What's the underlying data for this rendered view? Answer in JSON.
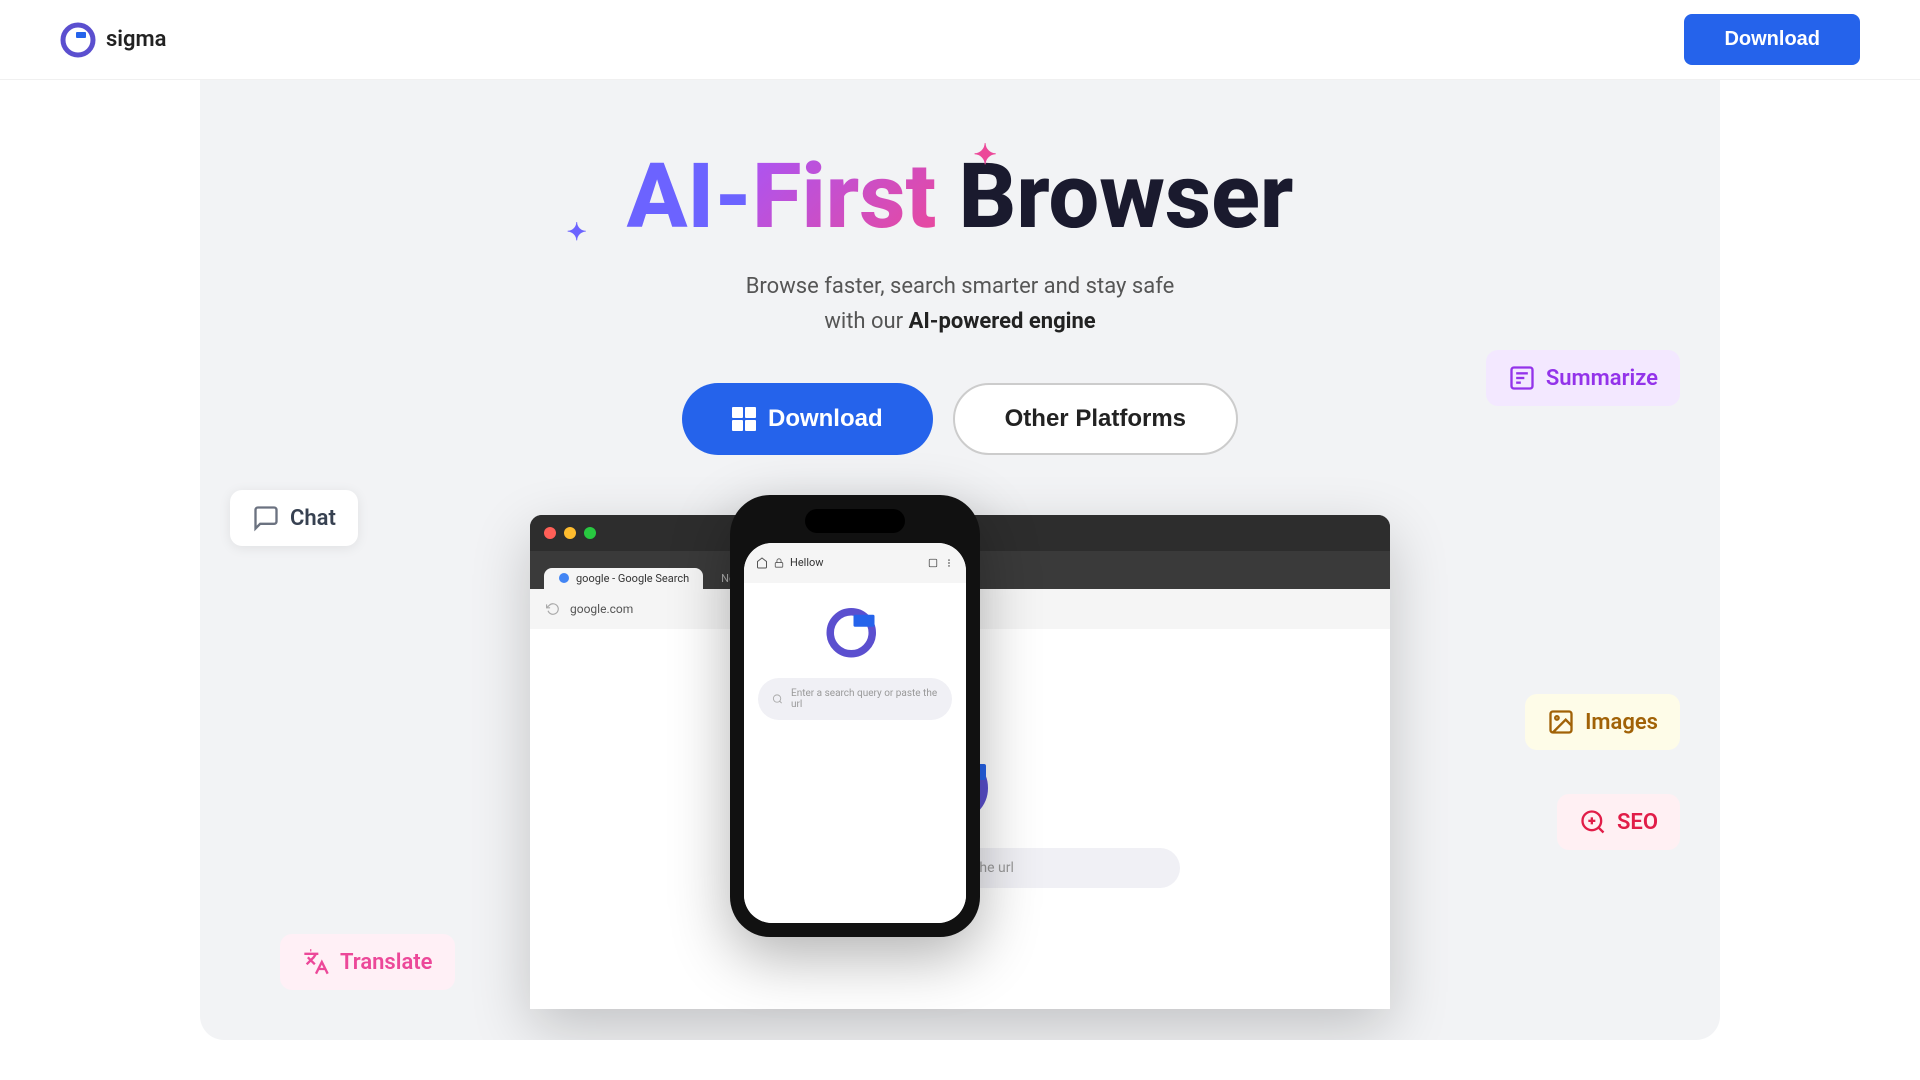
{
  "header": {
    "logo_text": "sigma",
    "download_btn": "Download"
  },
  "hero": {
    "title_ai": "AI-",
    "title_first": "First",
    "title_browser": " Browser",
    "subtitle_line1": "Browse faster, search smarter and stay safe",
    "subtitle_line2": "with our ",
    "subtitle_bold": "AI-powered engine",
    "btn_download": "Download",
    "btn_other": "Other Platforms"
  },
  "badges": {
    "summarize": "Summarize",
    "chat": "Chat",
    "translate": "Translate",
    "images": "Images",
    "seo": "SEO"
  },
  "browser": {
    "tab1": "google - Google Search",
    "tab2": "New Tab",
    "address": "google.com",
    "search_placeholder": "Enter a search query or paste the url",
    "phone_address": "Hellow"
  }
}
